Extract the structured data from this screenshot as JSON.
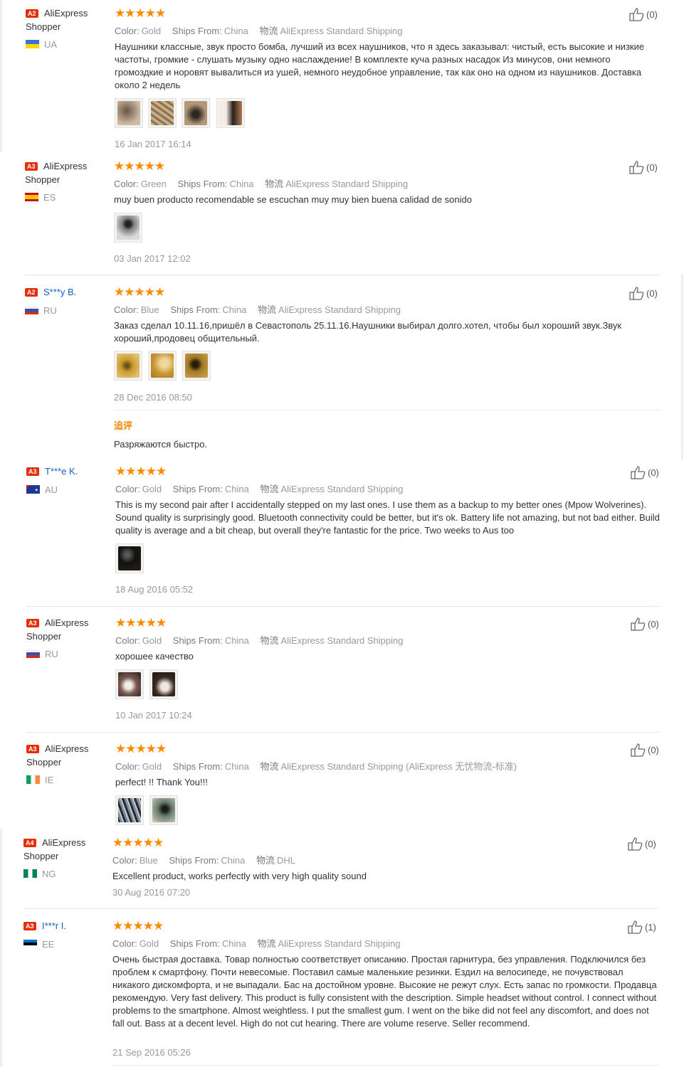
{
  "reviews": [
    {
      "level": "A2",
      "user": "AliExpress Shopper",
      "country": "UA",
      "stars": "★★★★★",
      "color_label": "Color:",
      "color": "Gold",
      "ships_label": "Ships From:",
      "ships": "China",
      "logistics_label": "物流",
      "logistics": "AliExpress Standard Shipping",
      "text": "Наушники классные, звук просто бомба, лучший из всех наушников, что я здесь заказывал: чистый, есть высокие и низкие частоты, громкие - слушать музыку одно наслаждение! В комплекте куча разных насадок Из минусов, они немного громоздкие и норовят вывалиться из ушей, немного неудобное управление, так как оно на одном из наушников. Доставка около 2 недель",
      "date": "16 Jan 2017 16:14",
      "likes": "(0)"
    },
    {
      "level": "A3",
      "user": "AliExpress Shopper",
      "country": "ES",
      "stars": "★★★★★",
      "color_label": "Color:",
      "color": "Green",
      "ships_label": "Ships From:",
      "ships": "China",
      "logistics_label": "物流",
      "logistics": "AliExpress Standard Shipping",
      "text": "muy buen producto recomendable se escuchan muy muy bien buena calidad de sonido",
      "date": "03 Jan 2017 12:02",
      "likes": "(0)"
    },
    {
      "level": "A2",
      "user": "S***y B.",
      "country": "RU",
      "stars": "★★★★★",
      "color_label": "Color:",
      "color": "Blue",
      "ships_label": "Ships From:",
      "ships": "China",
      "logistics_label": "物流",
      "logistics": "AliExpress Standard Shipping",
      "text": "Заказ сделал 10.11.16,пришёл в Севастополь 25.11.16.Наушники выбирал долго.хотел, чтобы был хороший звук.Звук хороший,продовец общительный.",
      "date": "28 Dec 2016 08:50",
      "append_title": "追评",
      "append_text": "Разряжаются быстро.",
      "likes": "(0)"
    },
    {
      "level": "A3",
      "user": "T***e K.",
      "country": "AU",
      "stars": "★★★★★",
      "color_label": "Color:",
      "color": "Gold",
      "ships_label": "Ships From:",
      "ships": "China",
      "logistics_label": "物流",
      "logistics": "AliExpress Standard Shipping",
      "text": "This is my second pair after I accidentally stepped on my last ones. I use them as a backup to my better ones (Mpow Wolverines). Sound quality is surprisingly good. Bluetooth connectivity could be better, but it's ok. Battery life not amazing, but not bad either. Build quality is average and a bit cheap, but overall they're fantastic for the price. Two weeks to Aus too",
      "date": "18 Aug 2016 05:52",
      "likes": "(0)"
    },
    {
      "level": "A3",
      "user": "AliExpress Shopper",
      "country": "RU",
      "stars": "★★★★★",
      "color_label": "Color:",
      "color": "Gold",
      "ships_label": "Ships From:",
      "ships": "China",
      "logistics_label": "物流",
      "logistics": "AliExpress Standard Shipping",
      "text": "хорошее качество",
      "date": "10 Jan 2017 10:24",
      "likes": "(0)"
    },
    {
      "level": "A3",
      "user": "AliExpress Shopper",
      "country": "IE",
      "stars": "★★★★★",
      "color_label": "Color:",
      "color": "Gold",
      "ships_label": "Ships From:",
      "ships": "China",
      "logistics_label": "物流",
      "logistics": "AliExpress Standard Shipping (AliExpress 无忧物流-标准)",
      "text": "perfect! !! Thank You!!!",
      "likes": "(0)"
    },
    {
      "level": "A4",
      "user": "AliExpress Shopper",
      "country": "NG",
      "stars": "★★★★★",
      "color_label": "Color:",
      "color": "Blue",
      "ships_label": "Ships From:",
      "ships": "China",
      "logistics_label": "物流",
      "logistics": "DHL",
      "text": "Excellent product, works perfectly with very high quality sound",
      "date": "30 Aug 2016 07:20",
      "likes": "(0)"
    },
    {
      "level": "A3",
      "user": "I***r I.",
      "country": "EE",
      "stars": "★★★★★",
      "color_label": "Color:",
      "color": "Gold",
      "ships_label": "Ships From:",
      "ships": "China",
      "logistics_label": "物流",
      "logistics": "AliExpress Standard Shipping",
      "text": "Очень быстрая доставка. Товар полностью соответствует описанию. Простая гарнитура, без управления. Подключился без проблем к смартфону. Почти невесомые. Поставил самые маленькие резинки. Ездил на велосипеде, не почувствовал никакого дискомфорта, и не выпадали. Бас на достойном уровне. Высокие не режут слух. Есть запас по громкости. Продавца рекомендую. Very fast delivery. This product is fully consistent with the description. Simple headset without control. I connect without problems to the smartphone. Almost weightless. I put the smallest gum. I went on the bike did not feel any discomfort, and does not fall out. Bass at a decent level. High do not cut hearing. There are volume reserve. Seller recommend.",
      "date": "21 Sep 2016 05:26",
      "likes": "(1)"
    }
  ],
  "colors": {
    "accent": "#e62e04",
    "star": "#ff8a00",
    "link": "#1460c1"
  }
}
